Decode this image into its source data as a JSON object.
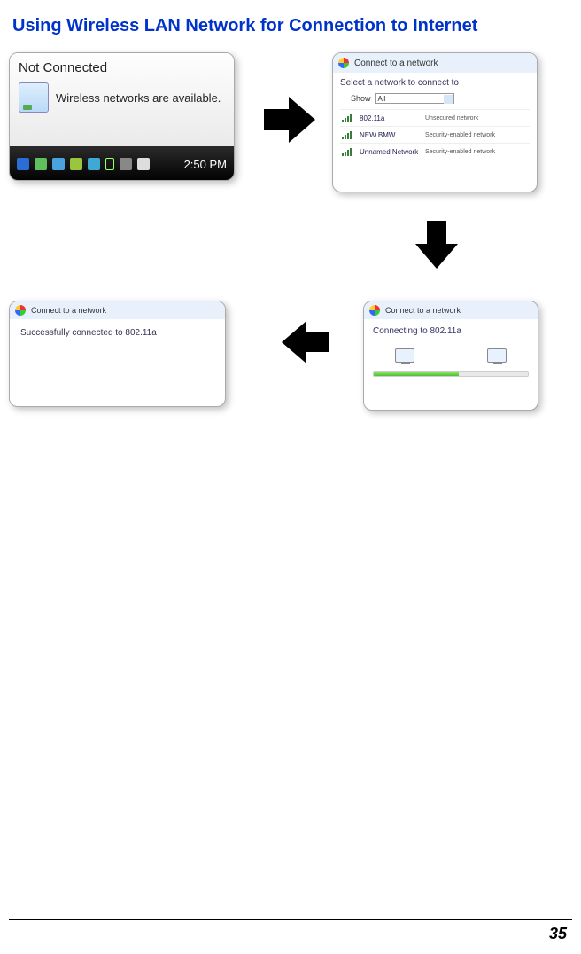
{
  "title": "Using Wireless LAN Network for Connection to Internet",
  "page_number": "35",
  "panel1": {
    "status": "Not Connected",
    "message": "Wireless networks are available.",
    "time": "2:50 PM"
  },
  "panel2": {
    "window_title": "Connect to a network",
    "subtitle": "Select a network to connect to",
    "show_label": "Show",
    "show_value": "All",
    "networks": [
      {
        "name": "802.11a",
        "type": "Unsecured network"
      },
      {
        "name": "NEW BMW",
        "type": "Security-enabled network"
      },
      {
        "name": "Unnamed Network",
        "type": "Security-enabled network"
      }
    ]
  },
  "panel3": {
    "window_title": "Connect to a network",
    "message": "Connecting to 802.11a"
  },
  "panel4": {
    "window_title": "Connect to a network",
    "message": "Successfully connected to 802.11a"
  }
}
